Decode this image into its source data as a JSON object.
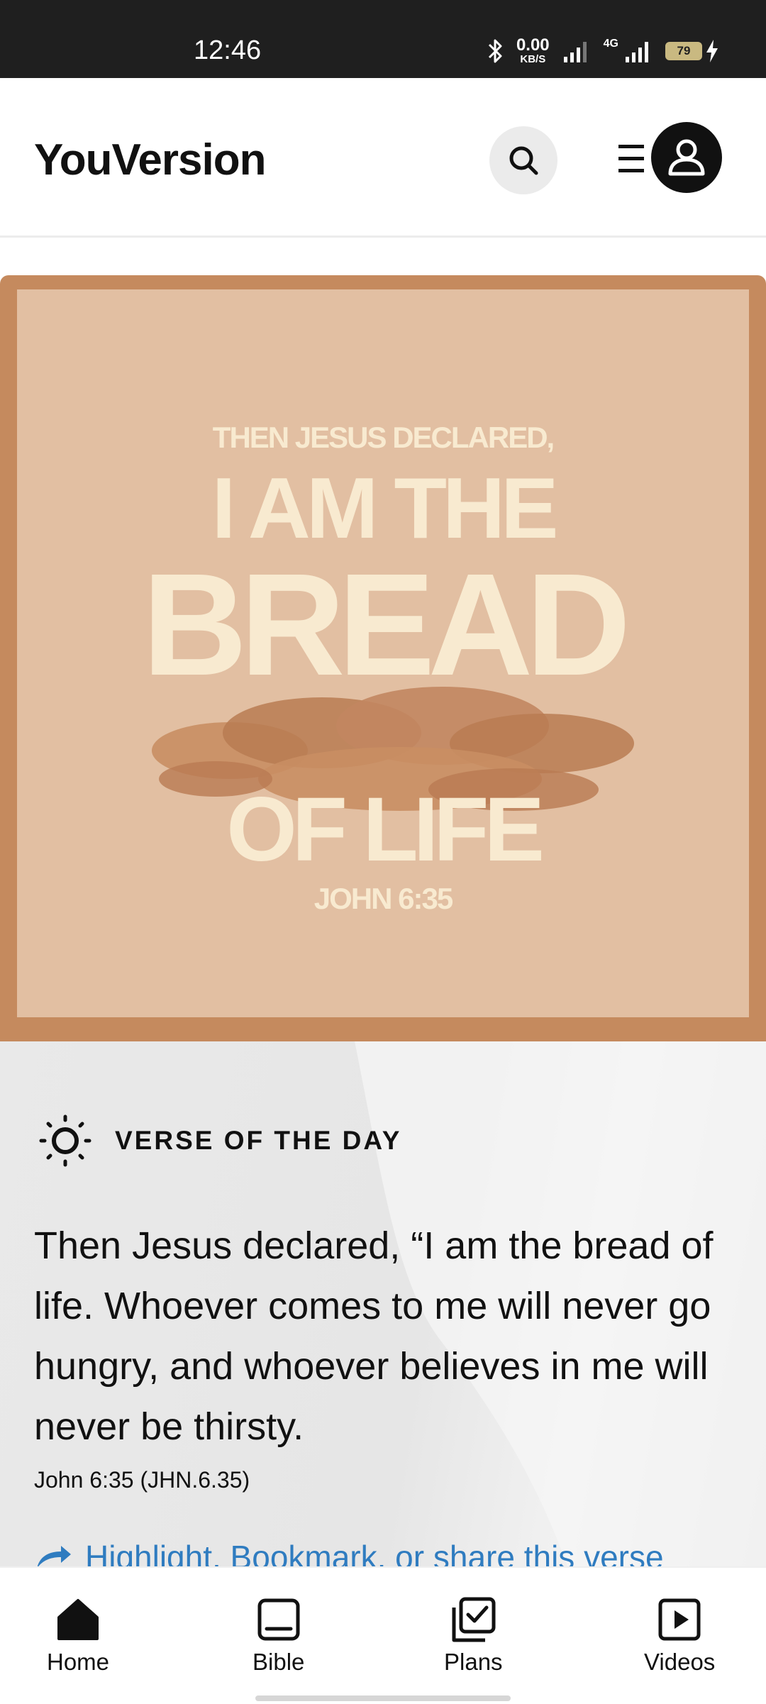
{
  "status_bar": {
    "time": "12:46",
    "net_speed_value": "0.00",
    "net_speed_unit": "KB/S",
    "network_type": "4G",
    "battery_level": "79",
    "icons": [
      "bluetooth-icon",
      "signal-icon",
      "signal-4g-icon",
      "battery-icon",
      "charging-icon"
    ]
  },
  "header": {
    "logo": "YouVersion",
    "icons": [
      "search-icon",
      "menu-icon",
      "profile-icon"
    ]
  },
  "verse_image": {
    "line1": "THEN JESUS DECLARED,",
    "line2": "I AM THE",
    "line3": "BREAD",
    "line4": "OF LIFE",
    "reference": "JOHN 6:35",
    "colors": {
      "border": "#c58a5e",
      "background": "#e2bfa2",
      "text": "#f8ead0"
    }
  },
  "verse_of_the_day": {
    "label": "VERSE OF THE DAY",
    "icon": "sun-icon",
    "text": "Then Jesus declared, “I am the bread of life. Whoever comes to me will never go hungry, and whoever believes in me will never be thirsty.",
    "reference": "John 6:35 (JHN.6.35)",
    "action_label": "Highlight, Bookmark, or share this verse",
    "action_color": "#2f7cc0"
  },
  "bottom_nav": {
    "items": [
      {
        "label": "Home",
        "icon": "home-icon",
        "active": true
      },
      {
        "label": "Bible",
        "icon": "bible-icon"
      },
      {
        "label": "Plans",
        "icon": "plans-icon"
      },
      {
        "label": "Videos",
        "icon": "videos-icon"
      }
    ]
  }
}
